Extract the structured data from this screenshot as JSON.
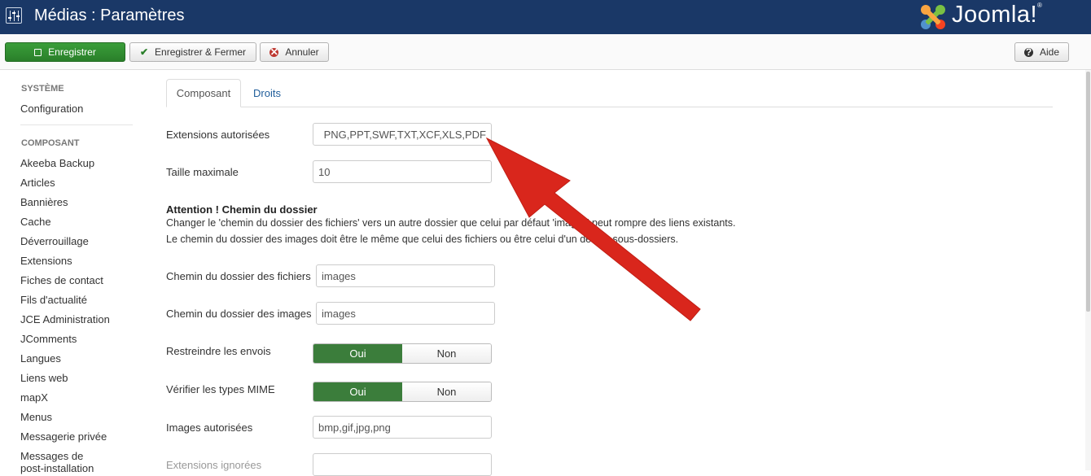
{
  "header": {
    "title": "Médias : Paramètres",
    "logo_text": "Joomla!",
    "registered_mark": "®",
    "background": "#1a3867"
  },
  "toolbar": {
    "save_label": "Enregistrer",
    "save_close_label": "Enregistrer & Fermer",
    "cancel_label": "Annuler",
    "help_label": "Aide",
    "check_glyph": "✔",
    "cancel_glyph": "✕",
    "help_glyph": "?"
  },
  "sidebar": {
    "system_title": "SYSTÈME",
    "system_items": [
      "Configuration"
    ],
    "component_title": "COMPOSANT",
    "component_items": [
      "Akeeba Backup",
      "Articles",
      "Bannières",
      "Cache",
      "Déverrouillage",
      "Extensions",
      "Fiches de contact",
      "Fils d'actualité",
      "JCE Administration",
      "JComments",
      "Langues",
      "Liens web",
      "mapX",
      "Menus",
      "Messagerie privée",
      "Messages de",
      "post-installation"
    ]
  },
  "tabs": [
    {
      "label": "Composant",
      "active": true
    },
    {
      "label": "Droits",
      "active": false
    }
  ],
  "form": {
    "allowed_extensions_label": "Extensions autorisées",
    "allowed_extensions_value": "PNG,PPT,SWF,TXT,XCF,XLS,PDF",
    "max_size_label": "Taille maximale",
    "max_size_value": "10",
    "notice_title": "Attention ! Chemin du dossier",
    "notice_line1": "Changer le 'chemin du dossier des fichiers' vers un autre dossier que celui par défaut 'images' peut rompre des liens existants.",
    "notice_line2": "Le chemin du dossier des images doit être le même que celui des fichiers ou être celui d'un de ses sous-dossiers.",
    "file_path_label": "Chemin du dossier des fichiers",
    "file_path_value": "images",
    "image_path_label": "Chemin du dossier des images",
    "image_path_value": "images",
    "restrict_uploads_label": "Restreindre les envois",
    "check_mime_label": "Vérifier les types MIME",
    "yes_label": "Oui",
    "no_label": "Non",
    "allowed_images_label": "Images autorisées",
    "allowed_images_value": "bmp,gif,jpg,png",
    "ignored_extensions_label": "Extensions ignorées",
    "ignored_extensions_value": ""
  },
  "colors": {
    "accent_green": "#2a7f2a",
    "toggle_on": "#3b7d3b",
    "link_blue": "#1f5d9a",
    "annotation_red": "#d9261c"
  }
}
